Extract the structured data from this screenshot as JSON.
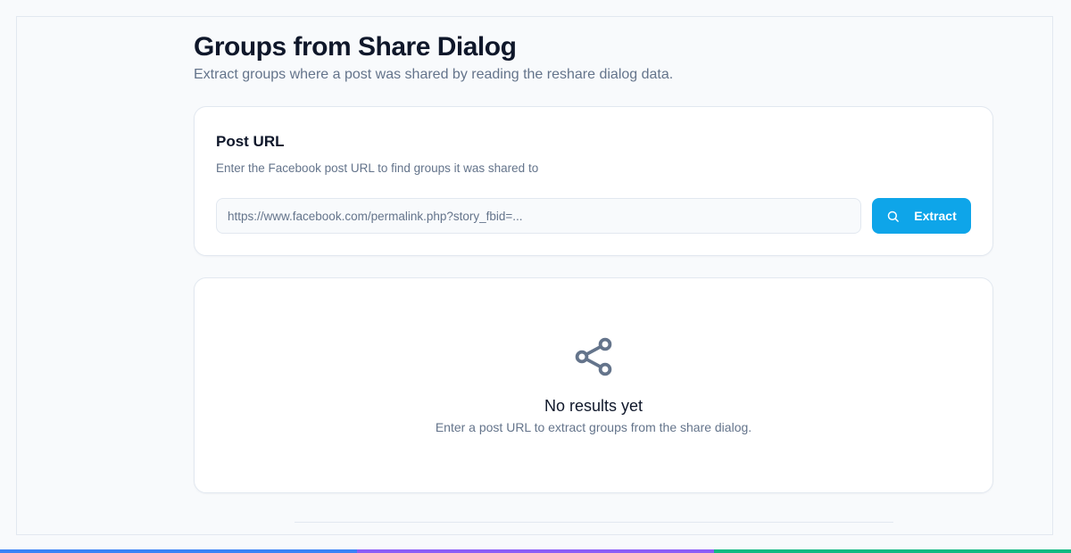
{
  "header": {
    "title": "Groups from Share Dialog",
    "subtitle": "Extract groups where a post was shared by reading the reshare dialog data."
  },
  "url_card": {
    "title": "Post URL",
    "description": "Enter the Facebook post URL to find groups it was shared to",
    "input_value": "",
    "input_placeholder": "https://www.facebook.com/permalink.php?story_fbid=...",
    "extract_button": {
      "label": "Extract",
      "icon": "search-icon"
    }
  },
  "results_card": {
    "icon": "share-icon",
    "empty_title": "No results yet",
    "empty_description": "Enter a post URL to extract groups from the share dialog."
  },
  "colors": {
    "accent": "#0ea5e9",
    "icon_gray": "#64748b",
    "bottom_bar": [
      "#3b82f6",
      "#8b5cf6",
      "#10b981"
    ]
  }
}
